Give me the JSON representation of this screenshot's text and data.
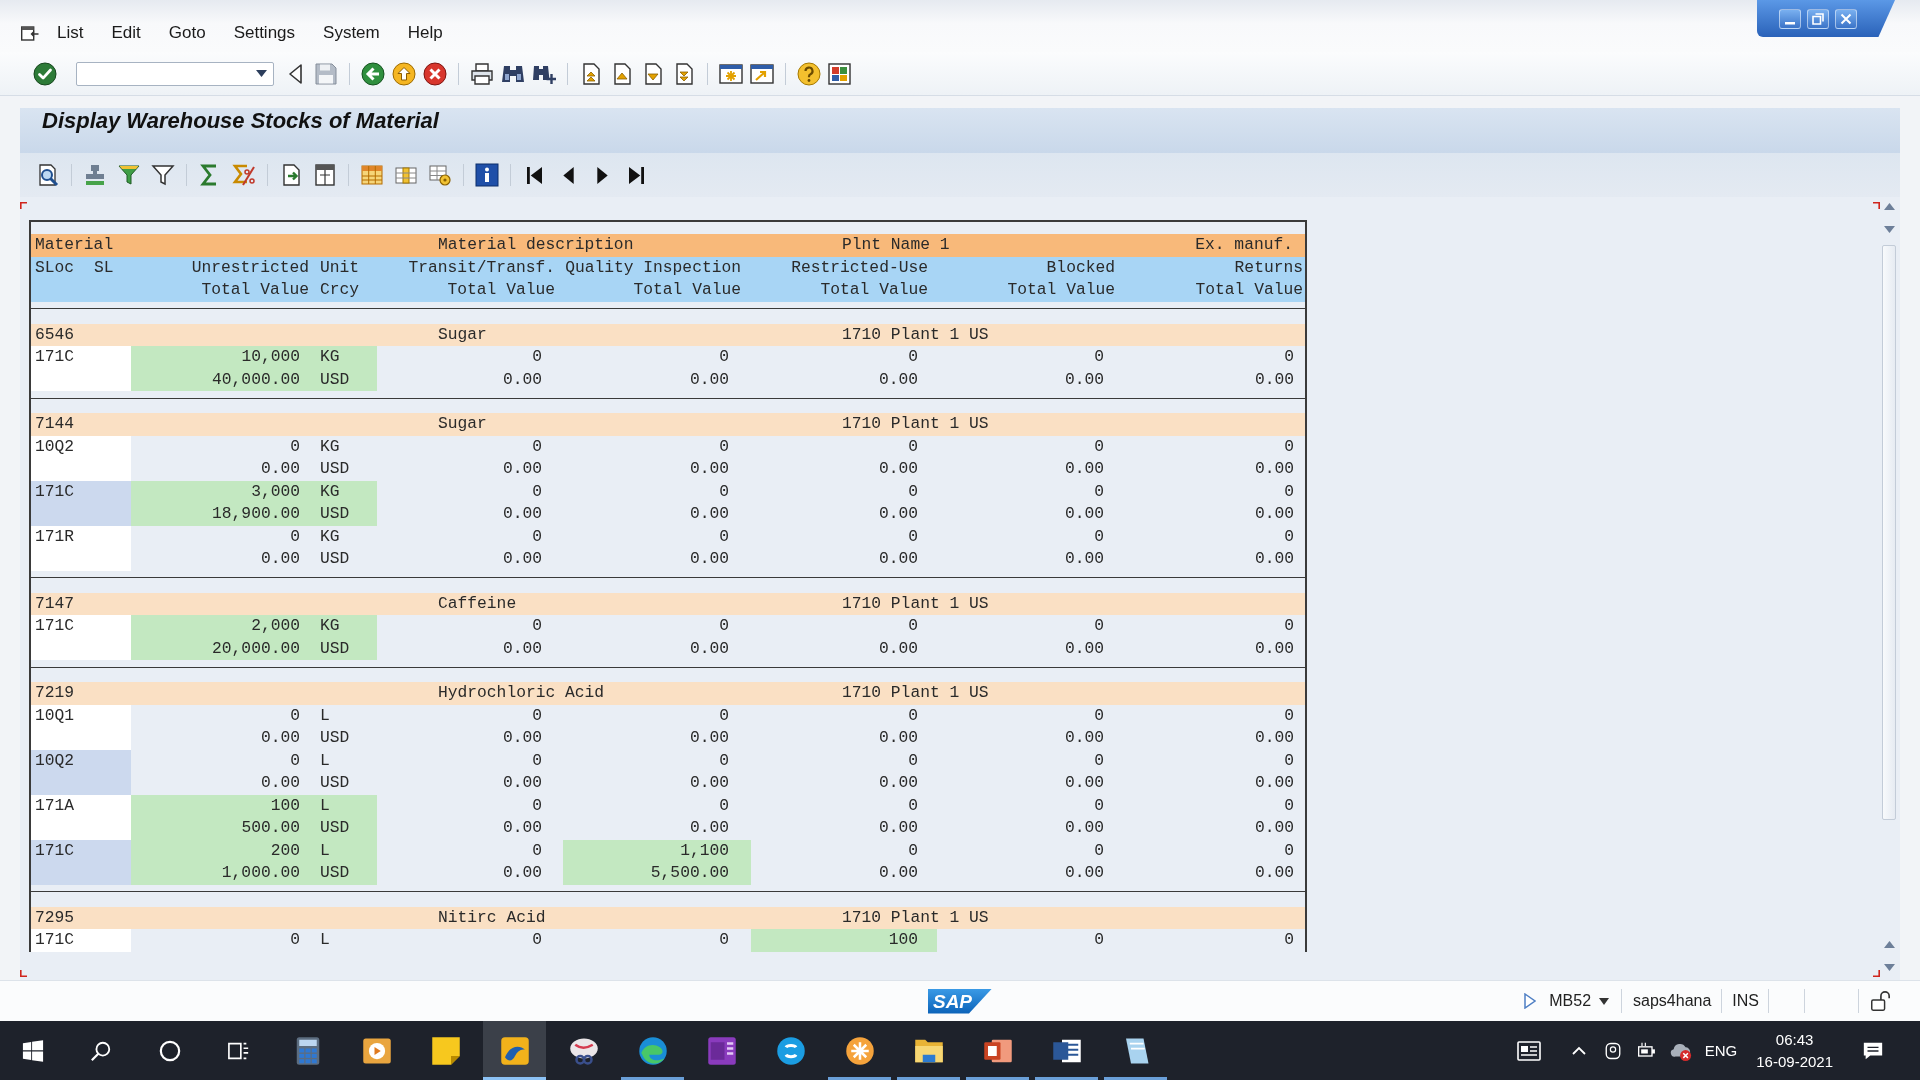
{
  "menu_bar": {
    "items": [
      "List",
      "Edit",
      "Goto",
      "Settings",
      "System",
      "Help"
    ]
  },
  "standard_toolbar": {
    "save": {
      "disabled": true
    }
  },
  "title": "Display Warehouse Stocks of Material",
  "list": {
    "header": {
      "row_1": [
        "Material",
        "Material description",
        "Plnt Name 1",
        "Ex. manuf."
      ],
      "row_2": [
        "SLoc",
        "SL",
        "Unrestricted",
        "Unit",
        "Transit/Transf.",
        "Quality Inspection",
        "Restricted-Use",
        "Blocked",
        "Returns"
      ],
      "row_3": [
        "Total Value",
        "Crcy",
        "Total Value",
        "Total Value",
        "Total Value",
        "Total Value",
        "Total Value"
      ]
    },
    "materials": [
      {
        "material": "6546",
        "description": "Sugar",
        "plant": "1710 Plant 1 US",
        "stocks": [
          {
            "sloc": "171C",
            "lines": [
              {
                "unit": "KG",
                "cells": [
                  {
                    "text": "10,000",
                    "highlighted": true
                  },
                  {
                    "text": "0",
                    "highlighted": false
                  },
                  {
                    "text": "0",
                    "highlighted": false
                  },
                  {
                    "text": "0",
                    "highlighted": false
                  },
                  {
                    "text": "0",
                    "highlighted": false
                  },
                  {
                    "text": "0",
                    "highlighted": false
                  }
                ]
              },
              {
                "unit": "USD",
                "cells": [
                  {
                    "text": "40,000.00",
                    "highlighted": true
                  },
                  {
                    "text": "0.00",
                    "highlighted": false
                  },
                  {
                    "text": "0.00",
                    "highlighted": false
                  },
                  {
                    "text": "0.00",
                    "highlighted": false
                  },
                  {
                    "text": "0.00",
                    "highlighted": false
                  },
                  {
                    "text": "0.00",
                    "highlighted": false
                  }
                ]
              }
            ]
          }
        ]
      },
      {
        "material": "7144",
        "description": "Sugar",
        "plant": "1710 Plant 1 US",
        "stocks": [
          {
            "sloc": "10Q2",
            "lines": [
              {
                "unit": "KG",
                "cells": [
                  {
                    "text": "0",
                    "highlighted": false
                  },
                  {
                    "text": "0",
                    "highlighted": false
                  },
                  {
                    "text": "0",
                    "highlighted": false
                  },
                  {
                    "text": "0",
                    "highlighted": false
                  },
                  {
                    "text": "0",
                    "highlighted": false
                  },
                  {
                    "text": "0",
                    "highlighted": false
                  }
                ]
              },
              {
                "unit": "USD",
                "cells": [
                  {
                    "text": "0.00",
                    "highlighted": false
                  },
                  {
                    "text": "0.00",
                    "highlighted": false
                  },
                  {
                    "text": "0.00",
                    "highlighted": false
                  },
                  {
                    "text": "0.00",
                    "highlighted": false
                  },
                  {
                    "text": "0.00",
                    "highlighted": false
                  },
                  {
                    "text": "0.00",
                    "highlighted": false
                  }
                ]
              }
            ]
          },
          {
            "sloc": "171C",
            "lines": [
              {
                "unit": "KG",
                "cells": [
                  {
                    "text": "3,000",
                    "highlighted": true
                  },
                  {
                    "text": "0",
                    "highlighted": false
                  },
                  {
                    "text": "0",
                    "highlighted": false
                  },
                  {
                    "text": "0",
                    "highlighted": false
                  },
                  {
                    "text": "0",
                    "highlighted": false
                  },
                  {
                    "text": "0",
                    "highlighted": false
                  }
                ]
              },
              {
                "unit": "USD",
                "cells": [
                  {
                    "text": "18,900.00",
                    "highlighted": true
                  },
                  {
                    "text": "0.00",
                    "highlighted": false
                  },
                  {
                    "text": "0.00",
                    "highlighted": false
                  },
                  {
                    "text": "0.00",
                    "highlighted": false
                  },
                  {
                    "text": "0.00",
                    "highlighted": false
                  },
                  {
                    "text": "0.00",
                    "highlighted": false
                  }
                ]
              }
            ]
          },
          {
            "sloc": "171R",
            "lines": [
              {
                "unit": "KG",
                "cells": [
                  {
                    "text": "0",
                    "highlighted": false
                  },
                  {
                    "text": "0",
                    "highlighted": false
                  },
                  {
                    "text": "0",
                    "highlighted": false
                  },
                  {
                    "text": "0",
                    "highlighted": false
                  },
                  {
                    "text": "0",
                    "highlighted": false
                  },
                  {
                    "text": "0",
                    "highlighted": false
                  }
                ]
              },
              {
                "unit": "USD",
                "cells": [
                  {
                    "text": "0.00",
                    "highlighted": false
                  },
                  {
                    "text": "0.00",
                    "highlighted": false
                  },
                  {
                    "text": "0.00",
                    "highlighted": false
                  },
                  {
                    "text": "0.00",
                    "highlighted": false
                  },
                  {
                    "text": "0.00",
                    "highlighted": false
                  },
                  {
                    "text": "0.00",
                    "highlighted": false
                  }
                ]
              }
            ]
          }
        ]
      },
      {
        "material": "7147",
        "description": "Caffeine",
        "plant": "1710 Plant 1 US",
        "stocks": [
          {
            "sloc": "171C",
            "lines": [
              {
                "unit": "KG",
                "cells": [
                  {
                    "text": "2,000",
                    "highlighted": true
                  },
                  {
                    "text": "0",
                    "highlighted": false
                  },
                  {
                    "text": "0",
                    "highlighted": false
                  },
                  {
                    "text": "0",
                    "highlighted": false
                  },
                  {
                    "text": "0",
                    "highlighted": false
                  },
                  {
                    "text": "0",
                    "highlighted": false
                  }
                ]
              },
              {
                "unit": "USD",
                "cells": [
                  {
                    "text": "20,000.00",
                    "highlighted": true
                  },
                  {
                    "text": "0.00",
                    "highlighted": false
                  },
                  {
                    "text": "0.00",
                    "highlighted": false
                  },
                  {
                    "text": "0.00",
                    "highlighted": false
                  },
                  {
                    "text": "0.00",
                    "highlighted": false
                  },
                  {
                    "text": "0.00",
                    "highlighted": false
                  }
                ]
              }
            ]
          }
        ]
      },
      {
        "material": "7219",
        "description": "Hydrochloric Acid",
        "plant": "1710 Plant 1 US",
        "stocks": [
          {
            "sloc": "10Q1",
            "lines": [
              {
                "unit": "L",
                "cells": [
                  {
                    "text": "0",
                    "highlighted": false
                  },
                  {
                    "text": "0",
                    "highlighted": false
                  },
                  {
                    "text": "0",
                    "highlighted": false
                  },
                  {
                    "text": "0",
                    "highlighted": false
                  },
                  {
                    "text": "0",
                    "highlighted": false
                  },
                  {
                    "text": "0",
                    "highlighted": false
                  }
                ]
              },
              {
                "unit": "USD",
                "cells": [
                  {
                    "text": "0.00",
                    "highlighted": false
                  },
                  {
                    "text": "0.00",
                    "highlighted": false
                  },
                  {
                    "text": "0.00",
                    "highlighted": false
                  },
                  {
                    "text": "0.00",
                    "highlighted": false
                  },
                  {
                    "text": "0.00",
                    "highlighted": false
                  },
                  {
                    "text": "0.00",
                    "highlighted": false
                  }
                ]
              }
            ]
          },
          {
            "sloc": "10Q2",
            "lines": [
              {
                "unit": "L",
                "cells": [
                  {
                    "text": "0",
                    "highlighted": false
                  },
                  {
                    "text": "0",
                    "highlighted": false
                  },
                  {
                    "text": "0",
                    "highlighted": false
                  },
                  {
                    "text": "0",
                    "highlighted": false
                  },
                  {
                    "text": "0",
                    "highlighted": false
                  },
                  {
                    "text": "0",
                    "highlighted": false
                  }
                ]
              },
              {
                "unit": "USD",
                "cells": [
                  {
                    "text": "0.00",
                    "highlighted": false
                  },
                  {
                    "text": "0.00",
                    "highlighted": false
                  },
                  {
                    "text": "0.00",
                    "highlighted": false
                  },
                  {
                    "text": "0.00",
                    "highlighted": false
                  },
                  {
                    "text": "0.00",
                    "highlighted": false
                  },
                  {
                    "text": "0.00",
                    "highlighted": false
                  }
                ]
              }
            ]
          },
          {
            "sloc": "171A",
            "lines": [
              {
                "unit": "L",
                "cells": [
                  {
                    "text": "100",
                    "highlighted": true
                  },
                  {
                    "text": "0",
                    "highlighted": false
                  },
                  {
                    "text": "0",
                    "highlighted": false
                  },
                  {
                    "text": "0",
                    "highlighted": false
                  },
                  {
                    "text": "0",
                    "highlighted": false
                  },
                  {
                    "text": "0",
                    "highlighted": false
                  }
                ]
              },
              {
                "unit": "USD",
                "cells": [
                  {
                    "text": "500.00",
                    "highlighted": true
                  },
                  {
                    "text": "0.00",
                    "highlighted": false
                  },
                  {
                    "text": "0.00",
                    "highlighted": false
                  },
                  {
                    "text": "0.00",
                    "highlighted": false
                  },
                  {
                    "text": "0.00",
                    "highlighted": false
                  },
                  {
                    "text": "0.00",
                    "highlighted": false
                  }
                ]
              }
            ]
          },
          {
            "sloc": "171C",
            "lines": [
              {
                "unit": "L",
                "cells": [
                  {
                    "text": "200",
                    "highlighted": true
                  },
                  {
                    "text": "0",
                    "highlighted": false
                  },
                  {
                    "text": "1,100",
                    "highlighted": true
                  },
                  {
                    "text": "0",
                    "highlighted": false
                  },
                  {
                    "text": "0",
                    "highlighted": false
                  },
                  {
                    "text": "0",
                    "highlighted": false
                  }
                ]
              },
              {
                "unit": "USD",
                "cells": [
                  {
                    "text": "1,000.00",
                    "highlighted": true
                  },
                  {
                    "text": "0.00",
                    "highlighted": false
                  },
                  {
                    "text": "5,500.00",
                    "highlighted": true
                  },
                  {
                    "text": "0.00",
                    "highlighted": false
                  },
                  {
                    "text": "0.00",
                    "highlighted": false
                  },
                  {
                    "text": "0.00",
                    "highlighted": false
                  }
                ]
              }
            ]
          }
        ]
      },
      {
        "material": "7295",
        "description": "Nitirc Acid",
        "plant": "1710 Plant 1 US",
        "stocks": [
          {
            "sloc": "171C",
            "lines": [
              {
                "unit": "L",
                "cells": [
                  {
                    "text": "0",
                    "highlighted": false
                  },
                  {
                    "text": "0",
                    "highlighted": false
                  },
                  {
                    "text": "0",
                    "highlighted": false
                  },
                  {
                    "text": "100",
                    "highlighted": true
                  },
                  {
                    "text": "0",
                    "highlighted": false
                  },
                  {
                    "text": "0",
                    "highlighted": false
                  }
                ]
              }
            ]
          }
        ]
      }
    ]
  },
  "status_bar": {
    "logo": "SAP",
    "transaction": "MB52",
    "system": "saps4hana",
    "mode": "INS"
  },
  "taskbar": {
    "apps": [
      {
        "running": false,
        "selected": false
      },
      {
        "running": false,
        "selected": false
      },
      {
        "running": false,
        "selected": false
      },
      {
        "running": true,
        "selected": true
      },
      {
        "running": false,
        "selected": false
      },
      {
        "running": true,
        "selected": false
      },
      {
        "running": false,
        "selected": false
      },
      {
        "running": false,
        "selected": false
      },
      {
        "running": true,
        "selected": false
      },
      {
        "running": true,
        "selected": false
      },
      {
        "running": true,
        "selected": false
      },
      {
        "running": true,
        "selected": false
      },
      {
        "running": true,
        "selected": false
      }
    ],
    "tray": {
      "language": "ENG",
      "time": "06:43",
      "date": "16-09-2021"
    }
  }
}
